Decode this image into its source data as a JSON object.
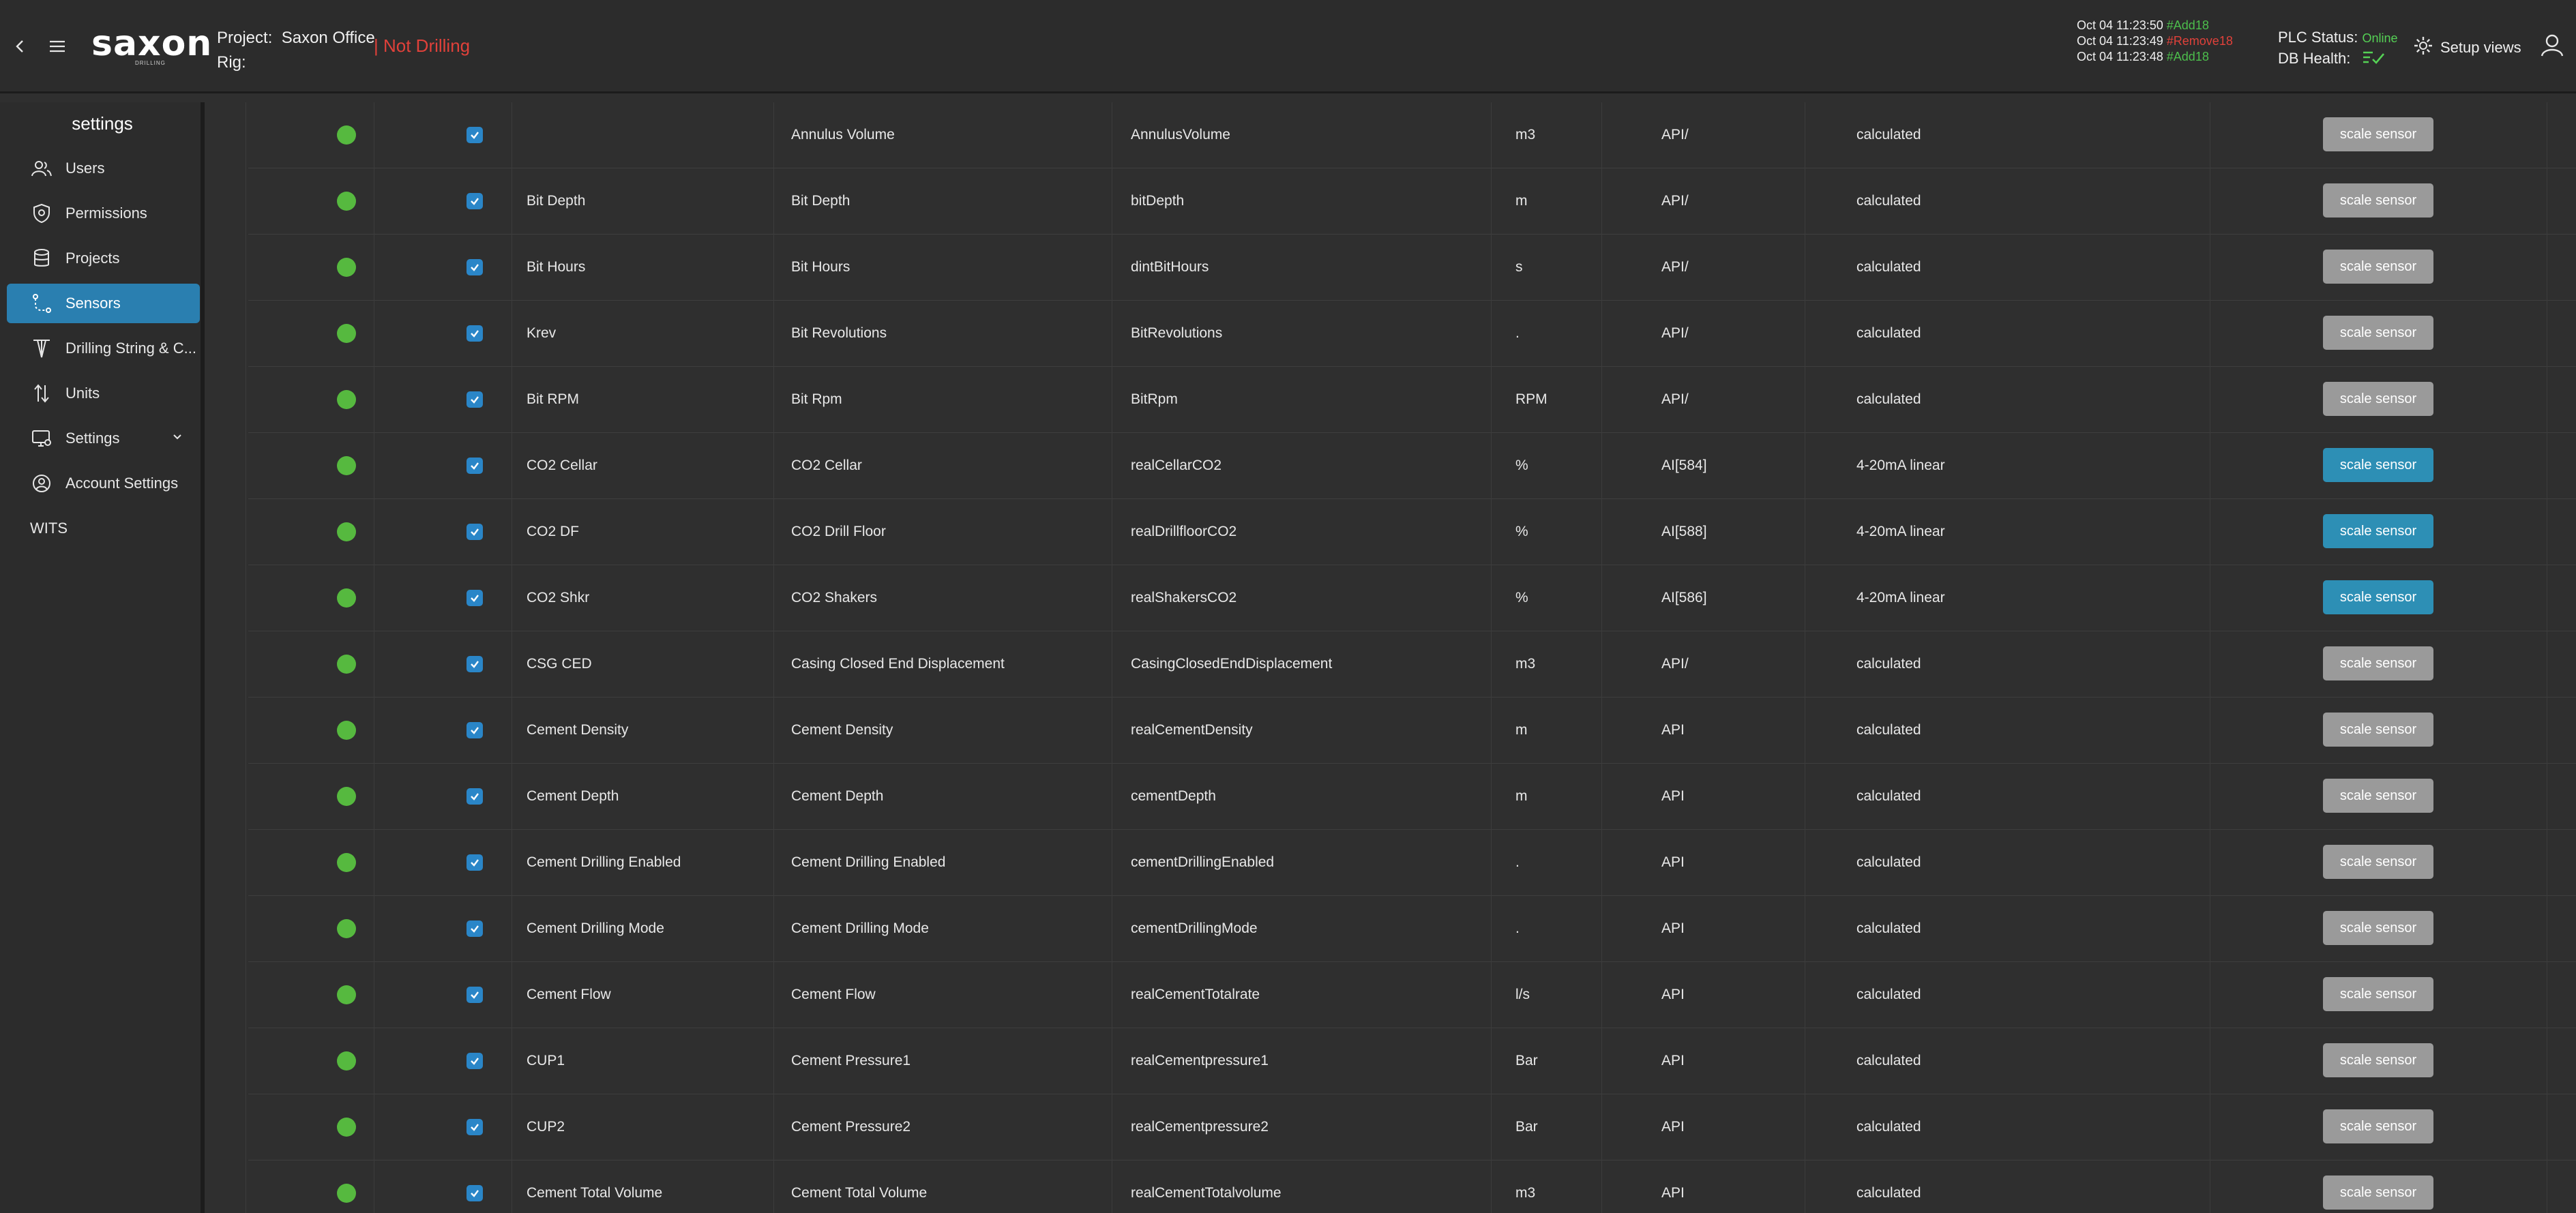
{
  "header": {
    "logo": "saxon",
    "logo_sub": "DRILLING",
    "project_label": "Project:",
    "project_value": "Saxon Office",
    "rig_label": "Rig:",
    "drilling_status": "| Not Drilling",
    "events": [
      {
        "time": "Oct 04 11:23:50",
        "tag": "#Add18",
        "type": "add"
      },
      {
        "time": "Oct 04 11:23:49",
        "tag": "#Remove18",
        "type": "remove"
      },
      {
        "time": "Oct 04 11:23:48",
        "tag": "#Add18",
        "type": "add"
      }
    ],
    "plc_label": "PLC Status:",
    "plc_value": "Online",
    "db_label": "DB Health:",
    "setup_views": "Setup views",
    "colors": {
      "online": "#55d155",
      "not_drilling": "#e0413a",
      "accent": "#2a7fb0"
    }
  },
  "sidebar": {
    "title": "settings",
    "items": [
      {
        "label": "Users",
        "icon": "users-icon"
      },
      {
        "label": "Permissions",
        "icon": "shield-icon"
      },
      {
        "label": "Projects",
        "icon": "database-icon"
      },
      {
        "label": "Sensors",
        "icon": "sensor-path-icon",
        "active": true
      },
      {
        "label": "Drilling String & C...",
        "icon": "drill-string-icon"
      },
      {
        "label": "Units",
        "icon": "units-arrows-icon"
      },
      {
        "label": "Settings",
        "icon": "monitor-settings-icon",
        "expandable": true
      },
      {
        "label": "Account Settings",
        "icon": "account-icon"
      },
      {
        "label": "WITS",
        "icon": ""
      }
    ]
  },
  "table": {
    "button_label": "scale sensor",
    "rows": [
      {
        "short": "",
        "name": "Annulus Volume",
        "var": "AnnulusVolume",
        "unit": "m3",
        "source": "API/",
        "scaling": "calculated",
        "btn": "gray"
      },
      {
        "short": "Bit Depth",
        "name": "Bit Depth",
        "var": "bitDepth",
        "unit": "m",
        "source": "API/",
        "scaling": "calculated",
        "btn": "gray"
      },
      {
        "short": "Bit Hours",
        "name": "Bit Hours",
        "var": "dintBitHours",
        "unit": "s",
        "source": "API/",
        "scaling": "calculated",
        "btn": "gray"
      },
      {
        "short": "Krev",
        "name": "Bit Revolutions",
        "var": "BitRevolutions",
        "unit": ".",
        "source": "API/",
        "scaling": "calculated",
        "btn": "gray"
      },
      {
        "short": "Bit RPM",
        "name": "Bit Rpm",
        "var": "BitRpm",
        "unit": "RPM",
        "source": "API/",
        "scaling": "calculated",
        "btn": "gray"
      },
      {
        "short": "CO2 Cellar",
        "name": "CO2 Cellar",
        "var": "realCellarCO2",
        "unit": "%",
        "source": "AI[584]",
        "scaling": "4-20mA linear",
        "btn": "blue"
      },
      {
        "short": "CO2 DF",
        "name": "CO2 Drill Floor",
        "var": "realDrillfloorCO2",
        "unit": "%",
        "source": "AI[588]",
        "scaling": "4-20mA linear",
        "btn": "blue"
      },
      {
        "short": "CO2 Shkr",
        "name": "CO2 Shakers",
        "var": "realShakersCO2",
        "unit": "%",
        "source": "AI[586]",
        "scaling": "4-20mA linear",
        "btn": "blue"
      },
      {
        "short": "CSG CED",
        "name": "Casing Closed End Displacement",
        "var": "CasingClosedEndDisplacement",
        "unit": "m3",
        "source": "API/",
        "scaling": "calculated",
        "btn": "gray"
      },
      {
        "short": "Cement Density",
        "name": "Cement Density",
        "var": "realCementDensity",
        "unit": "m",
        "source": "API",
        "scaling": "calculated",
        "btn": "gray"
      },
      {
        "short": "Cement Depth",
        "name": "Cement Depth",
        "var": "cementDepth",
        "unit": "m",
        "source": "API",
        "scaling": "calculated",
        "btn": "gray"
      },
      {
        "short": "Cement Drilling Enabled",
        "name": "Cement Drilling Enabled",
        "var": "cementDrillingEnabled",
        "unit": ".",
        "source": "API",
        "scaling": "calculated",
        "btn": "gray"
      },
      {
        "short": "Cement Drilling Mode",
        "name": "Cement Drilling Mode",
        "var": "cementDrillingMode",
        "unit": ".",
        "source": "API",
        "scaling": "calculated",
        "btn": "gray"
      },
      {
        "short": "Cement Flow",
        "name": "Cement Flow",
        "var": "realCementTotalrate",
        "unit": "l/s",
        "source": "API",
        "scaling": "calculated",
        "btn": "gray"
      },
      {
        "short": "CUP1",
        "name": "Cement Pressure1",
        "var": "realCementpressure1",
        "unit": "Bar",
        "source": "API",
        "scaling": "calculated",
        "btn": "gray"
      },
      {
        "short": "CUP2",
        "name": "Cement Pressure2",
        "var": "realCementpressure2",
        "unit": "Bar",
        "source": "API",
        "scaling": "calculated",
        "btn": "gray"
      },
      {
        "short": "Cement Total Volume",
        "name": "Cement Total Volume",
        "var": "realCementTotalvolume",
        "unit": "m3",
        "source": "API",
        "scaling": "calculated",
        "btn": "gray"
      }
    ]
  }
}
